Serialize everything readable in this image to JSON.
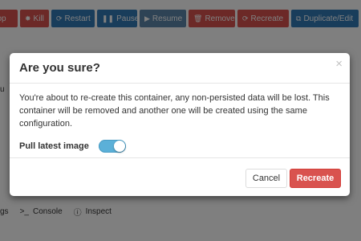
{
  "toolbar": {
    "buttons": [
      {
        "label": "op",
        "icon": "stop-icon"
      },
      {
        "label": "Kill",
        "icon": "bomb-icon"
      },
      {
        "label": "Restart",
        "icon": "refresh-icon"
      },
      {
        "label": "Pause",
        "icon": "pause-icon"
      },
      {
        "label": "Resume",
        "icon": "play-icon"
      },
      {
        "label": "Remove",
        "icon": "trash-icon"
      },
      {
        "label": "Recreate",
        "icon": "refresh-icon"
      },
      {
        "label": "Duplicate/Edit",
        "icon": "copy-icon"
      }
    ],
    "icons": {
      "stop": "■",
      "kill": "✸",
      "restart": "⟳",
      "pause": "❚❚",
      "resume": "▶",
      "remove": "🗑",
      "recreate": "⟳",
      "duplicate": "⧉"
    }
  },
  "side_fragment": "u",
  "bottom_links": [
    {
      "label": "gs",
      "icon": ""
    },
    {
      "label": "Console",
      "icon": ">_"
    },
    {
      "label": "Inspect",
      "icon": "ⓘ"
    }
  ],
  "modal": {
    "title": "Are you sure?",
    "close_symbol": "×",
    "message": "You're about to re-create this container, any non-persisted data will be lost. This container will be removed and another one will be created using the same configuration.",
    "pull_latest_label": "Pull latest image",
    "pull_latest_enabled": true,
    "cancel_label": "Cancel",
    "confirm_label": "Recreate"
  },
  "colors": {
    "danger": "#d9534f",
    "primary": "#337ab7",
    "switch_on": "#5bb0d8"
  }
}
